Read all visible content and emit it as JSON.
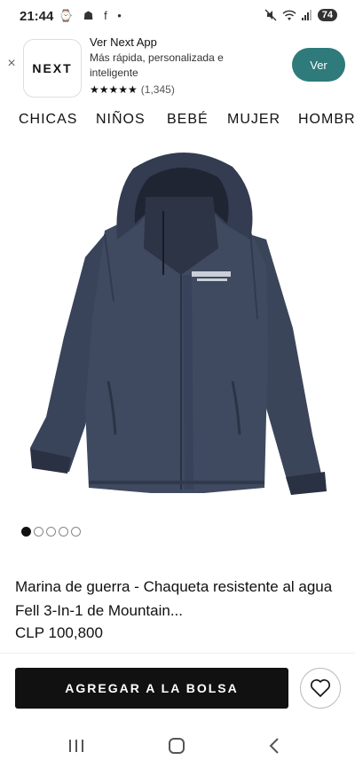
{
  "status_bar": {
    "time": "21:44",
    "left_icons": "⌚ ☗ f •",
    "battery": "74",
    "icons": [
      "screenshot-icon",
      "weather-icon",
      "facebook-icon",
      "dot-icon",
      "mute-icon",
      "wifi-icon",
      "signal-icon",
      "battery-icon"
    ]
  },
  "app_banner": {
    "close_label": "×",
    "logo_text": "NEXT",
    "title": "Ver Next App",
    "subtitle": "Más rápida, personalizada e inteligente",
    "stars": "★★★★★",
    "rating_count": "(1,345)",
    "cta_label": "Ver",
    "cta_color": "#2f7a7a"
  },
  "category_nav": {
    "items": [
      "CHICAS",
      "NIÑOS",
      "BEBÉ",
      "MUJER",
      "HOMBRE"
    ]
  },
  "product": {
    "image_alt": "Chaqueta azul marino 3 en 1",
    "image_dots_total": 5,
    "image_dots_active": 1,
    "title": "Marina de guerra - Chaqueta resistente al agua Fell 3-In-1 de Mountain...",
    "price": "CLP 100,800",
    "jacket_color": "#3b4559"
  },
  "actions": {
    "add_to_bag_label": "AGREGAR A LA BOLSA",
    "favorite_icon": "heart-icon"
  },
  "system_nav": {
    "icons": [
      "recent-apps-icon",
      "home-icon",
      "back-icon"
    ]
  }
}
